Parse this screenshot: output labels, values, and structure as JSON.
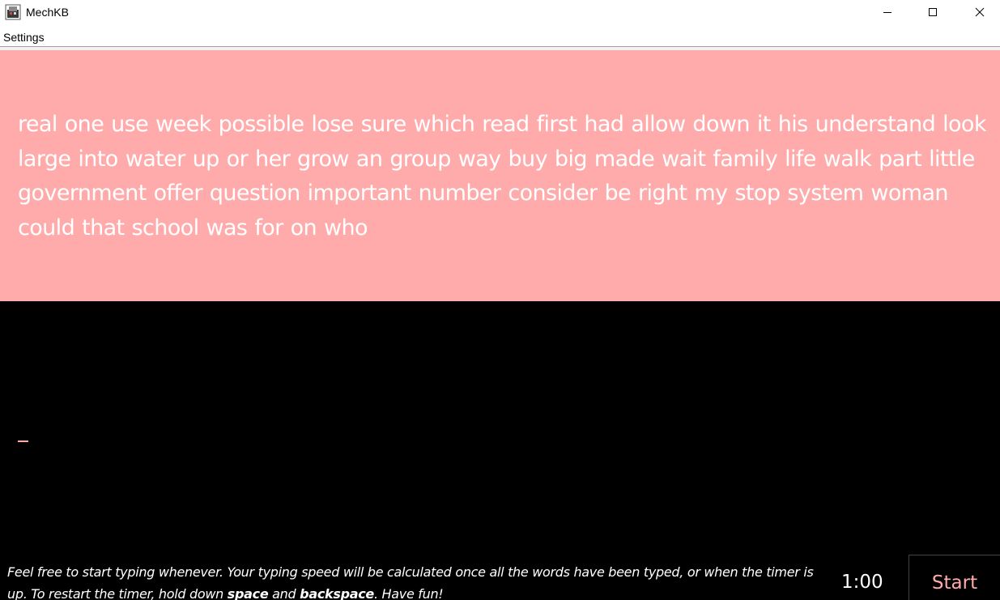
{
  "window": {
    "title": "MechKB",
    "controls": [
      "minimize-icon",
      "maximize-icon",
      "close-icon"
    ]
  },
  "menu": {
    "settings_label": "Settings"
  },
  "words": {
    "text": "real one use week possible lose sure which read first had allow down it his understand look large into water up or her grow an group way buy big made wait family life walk part little government offer question important number consider be right my stop system woman could that school was for on who"
  },
  "typing": {
    "input_value": ""
  },
  "footer": {
    "instructions_part1": "Feel free to start typing whenever. Your typing speed will be calculated once all the words have been typed, or when the timer is up. To restart the timer, hold down ",
    "key1": "space",
    "instructions_and": " and ",
    "key2": "backspace",
    "instructions_part2": ". Have fun!",
    "timer": "1:00",
    "start_label": "Start"
  },
  "colors": {
    "accent": "#ffabab",
    "background": "#000000",
    "text": "#ffffff"
  }
}
